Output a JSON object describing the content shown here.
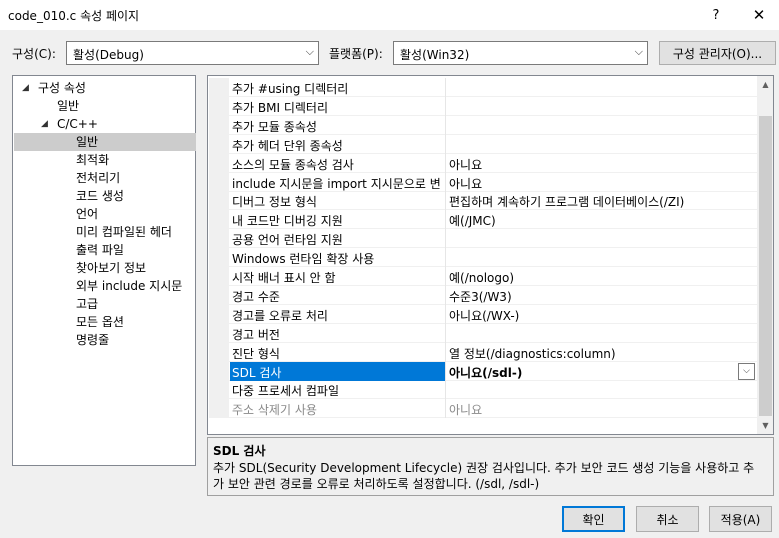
{
  "window": {
    "title": "code_010.c 속성 페이지",
    "help_label": "?",
    "close_label": "✕"
  },
  "config": {
    "configuration_label": "구성(C):",
    "configuration_value": "활성(Debug)",
    "platform_label": "플랫폼(P):",
    "platform_value": "활성(Win32)",
    "manager_button": "구성 관리자(O)..."
  },
  "tree": {
    "items": [
      {
        "label": "구성 속성",
        "expanded": true
      },
      {
        "label": "일반"
      },
      {
        "label": "C/C++",
        "expanded": true
      },
      {
        "label": "일반",
        "selected": true
      },
      {
        "label": "최적화"
      },
      {
        "label": "전처리기"
      },
      {
        "label": "코드 생성"
      },
      {
        "label": "언어"
      },
      {
        "label": "미리 컴파일된 헤더"
      },
      {
        "label": "출력 파일"
      },
      {
        "label": "찾아보기 정보"
      },
      {
        "label": "외부 include 지시문"
      },
      {
        "label": "고급"
      },
      {
        "label": "모든 옵션"
      },
      {
        "label": "명령줄"
      }
    ]
  },
  "properties": [
    {
      "name": "추가 #using 디렉터리",
      "value": ""
    },
    {
      "name": "추가 BMI 디렉터리",
      "value": ""
    },
    {
      "name": "추가 모듈 종속성",
      "value": ""
    },
    {
      "name": "추가 헤더 단위 종속성",
      "value": ""
    },
    {
      "name": "소스의 모듈 종속성 검사",
      "value": "아니요"
    },
    {
      "name": "include 지시문을 import 지시문으로 변",
      "value": "아니요"
    },
    {
      "name": "디버그 정보 형식",
      "value": "편집하며 계속하기 프로그램 데이터베이스(/ZI)"
    },
    {
      "name": "내 코드만 디버깅 지원",
      "value": "예(/JMC)"
    },
    {
      "name": "공용 언어 런타임 지원",
      "value": ""
    },
    {
      "name": "Windows 런타임 확장 사용",
      "value": ""
    },
    {
      "name": "시작 배너 표시 안 함",
      "value": "예(/nologo)"
    },
    {
      "name": "경고 수준",
      "value": "수준3(/W3)"
    },
    {
      "name": "경고를 오류로 처리",
      "value": "아니요(/WX-)"
    },
    {
      "name": "경고 버전",
      "value": ""
    },
    {
      "name": "진단 형식",
      "value": "열 정보(/diagnostics:column)"
    },
    {
      "name": "SDL 검사",
      "value": "아니요(/sdl-)",
      "selected": true
    },
    {
      "name": "다중 프로세서 컴파일",
      "value": ""
    },
    {
      "name": "주소 삭제기 사용",
      "value": "아니요",
      "disabled": true
    }
  ],
  "description": {
    "title": "SDL 검사",
    "text": "추가 SDL(Security Development Lifecycle) 권장 검사입니다. 추가 보안 코드 생성 기능을 사용하고 추가 보안 관련 경로를 오류로 처리하도록 설정합니다. (/sdl, /sdl-)"
  },
  "buttons": {
    "ok": "확인",
    "cancel": "취소",
    "apply": "적용(A)"
  },
  "colors": {
    "selection": "#0078d7",
    "tree_selection": "#cccccc",
    "dialog_bg": "#f0f0f0"
  }
}
